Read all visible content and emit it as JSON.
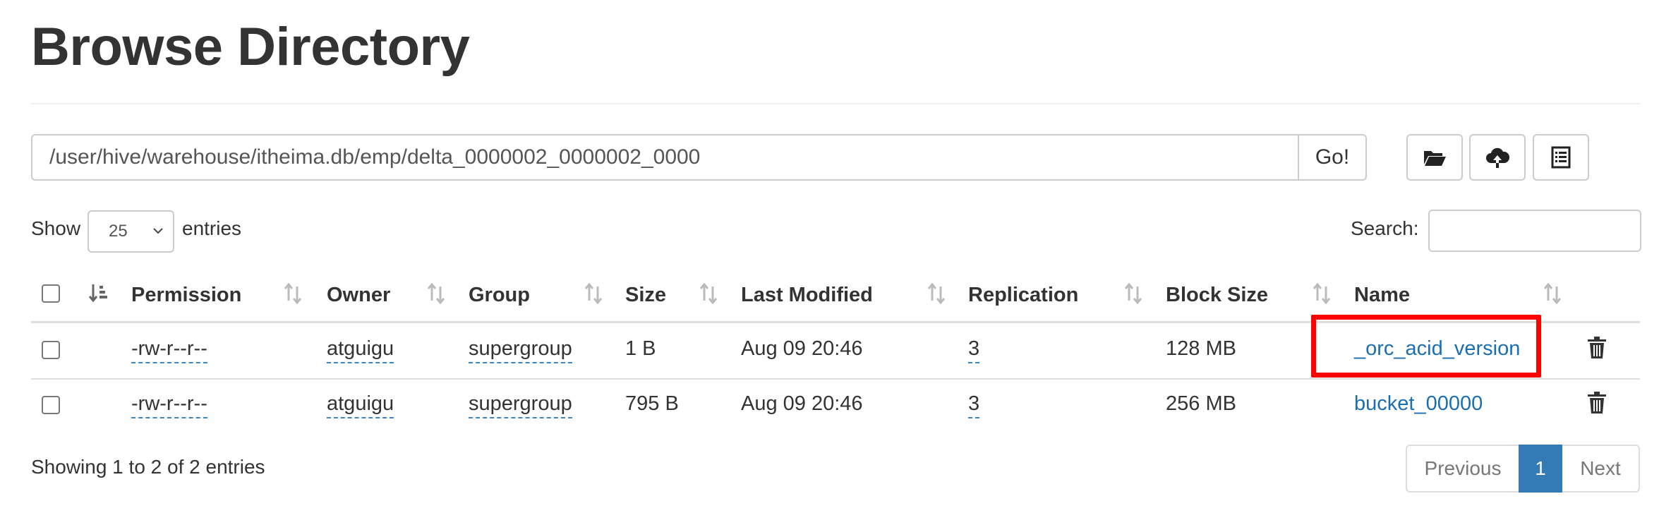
{
  "page": {
    "title": "Browse Directory"
  },
  "path_bar": {
    "value": "/user/hive/warehouse/itheima.db/emp/delta_0000002_0000002_0000",
    "go_label": "Go!"
  },
  "toolbar": {
    "icons": [
      "folder-open-icon",
      "cloud-upload-icon",
      "list-icon"
    ]
  },
  "length_menu": {
    "show_label": "Show",
    "value": "25",
    "entries_label": "entries"
  },
  "search": {
    "label": "Search:",
    "value": ""
  },
  "table": {
    "columns": [
      "Permission",
      "Owner",
      "Group",
      "Size",
      "Last Modified",
      "Replication",
      "Block Size",
      "Name"
    ],
    "rows": [
      {
        "permission": "-rw-r--r--",
        "owner": "atguigu",
        "group": "supergroup",
        "size": "1 B",
        "last_modified": "Aug 09 20:46",
        "replication": "3",
        "block_size": "128 MB",
        "name": "_orc_acid_version",
        "highlighted": true
      },
      {
        "permission": "-rw-r--r--",
        "owner": "atguigu",
        "group": "supergroup",
        "size": "795 B",
        "last_modified": "Aug 09 20:46",
        "replication": "3",
        "block_size": "256 MB",
        "name": "bucket_00000",
        "highlighted": false
      }
    ]
  },
  "footer": {
    "info": "Showing 1 to 2 of 2 entries",
    "pagination": {
      "previous": "Previous",
      "current": "1",
      "next": "Next"
    }
  },
  "colors": {
    "link": "#1a6fb3",
    "active_page": "#337ab7",
    "highlight": "#ff0000"
  }
}
